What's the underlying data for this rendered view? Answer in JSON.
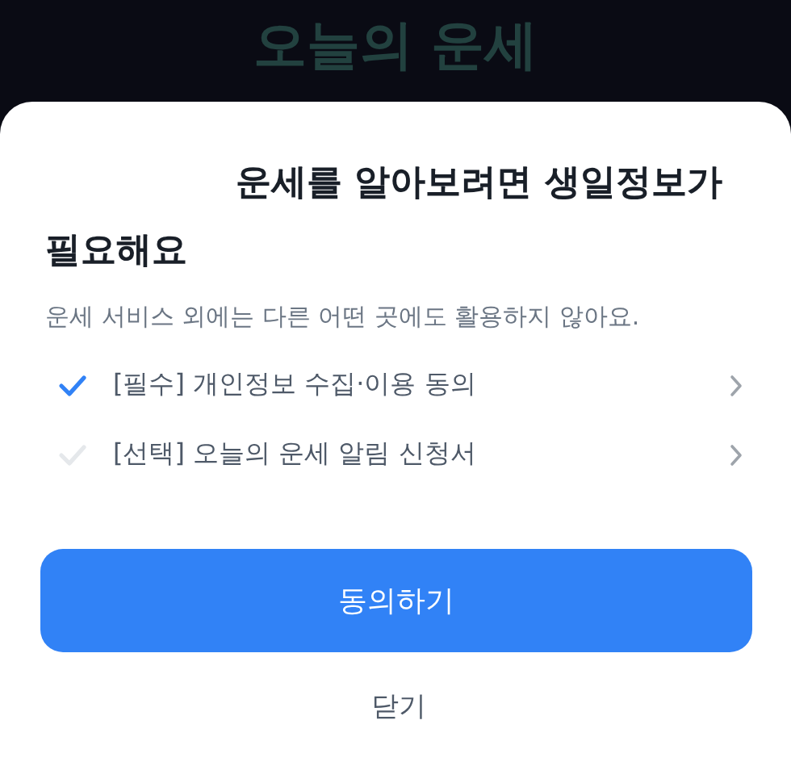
{
  "background": {
    "title": "오늘의 운세"
  },
  "sheet": {
    "heading": "운세를 알아보려면 생일정보가 필요해요",
    "description": "운세 서비스 외에는 다른 어떤 곳에도 활용하지 않아요.",
    "agreements": [
      {
        "label": "[필수] 개인정보 수집·이용 동의",
        "checked": true
      },
      {
        "label": "[선택] 오늘의 운세 알림 신청서",
        "checked": false
      }
    ],
    "primary_button": "동의하기",
    "close_button": "닫기"
  }
}
